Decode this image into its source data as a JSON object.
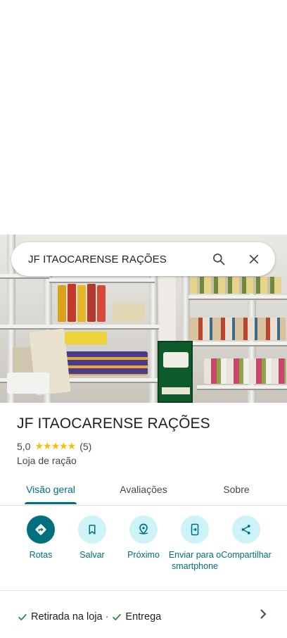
{
  "search": {
    "query": "JF ITAOCARENSE RAÇÕES"
  },
  "place": {
    "name": "JF ITAOCARENSE RAÇÕES",
    "rating": "5,0",
    "stars": "★★★★★",
    "review_count": "(5)",
    "category": "Loja de ração"
  },
  "tabs": [
    {
      "label": "Visão geral",
      "active": true
    },
    {
      "label": "Avaliações",
      "active": false
    },
    {
      "label": "Sobre",
      "active": false
    }
  ],
  "actions": [
    {
      "label": "Rotas",
      "icon": "directions-icon"
    },
    {
      "label": "Salvar",
      "icon": "bookmark-icon"
    },
    {
      "label": "Próximo",
      "icon": "nearby-icon"
    },
    {
      "label": "Enviar para o smartphone",
      "icon": "send-to-phone-icon"
    },
    {
      "label": "Compartilhar",
      "icon": "share-icon"
    }
  ],
  "services": {
    "item1": "Retirada na loja",
    "separator": "·",
    "item2": "Entrega"
  },
  "colors": {
    "accent": "#00707f",
    "accent_light": "#cdf3f9",
    "star": "#fbbc04",
    "check": "#188038"
  }
}
